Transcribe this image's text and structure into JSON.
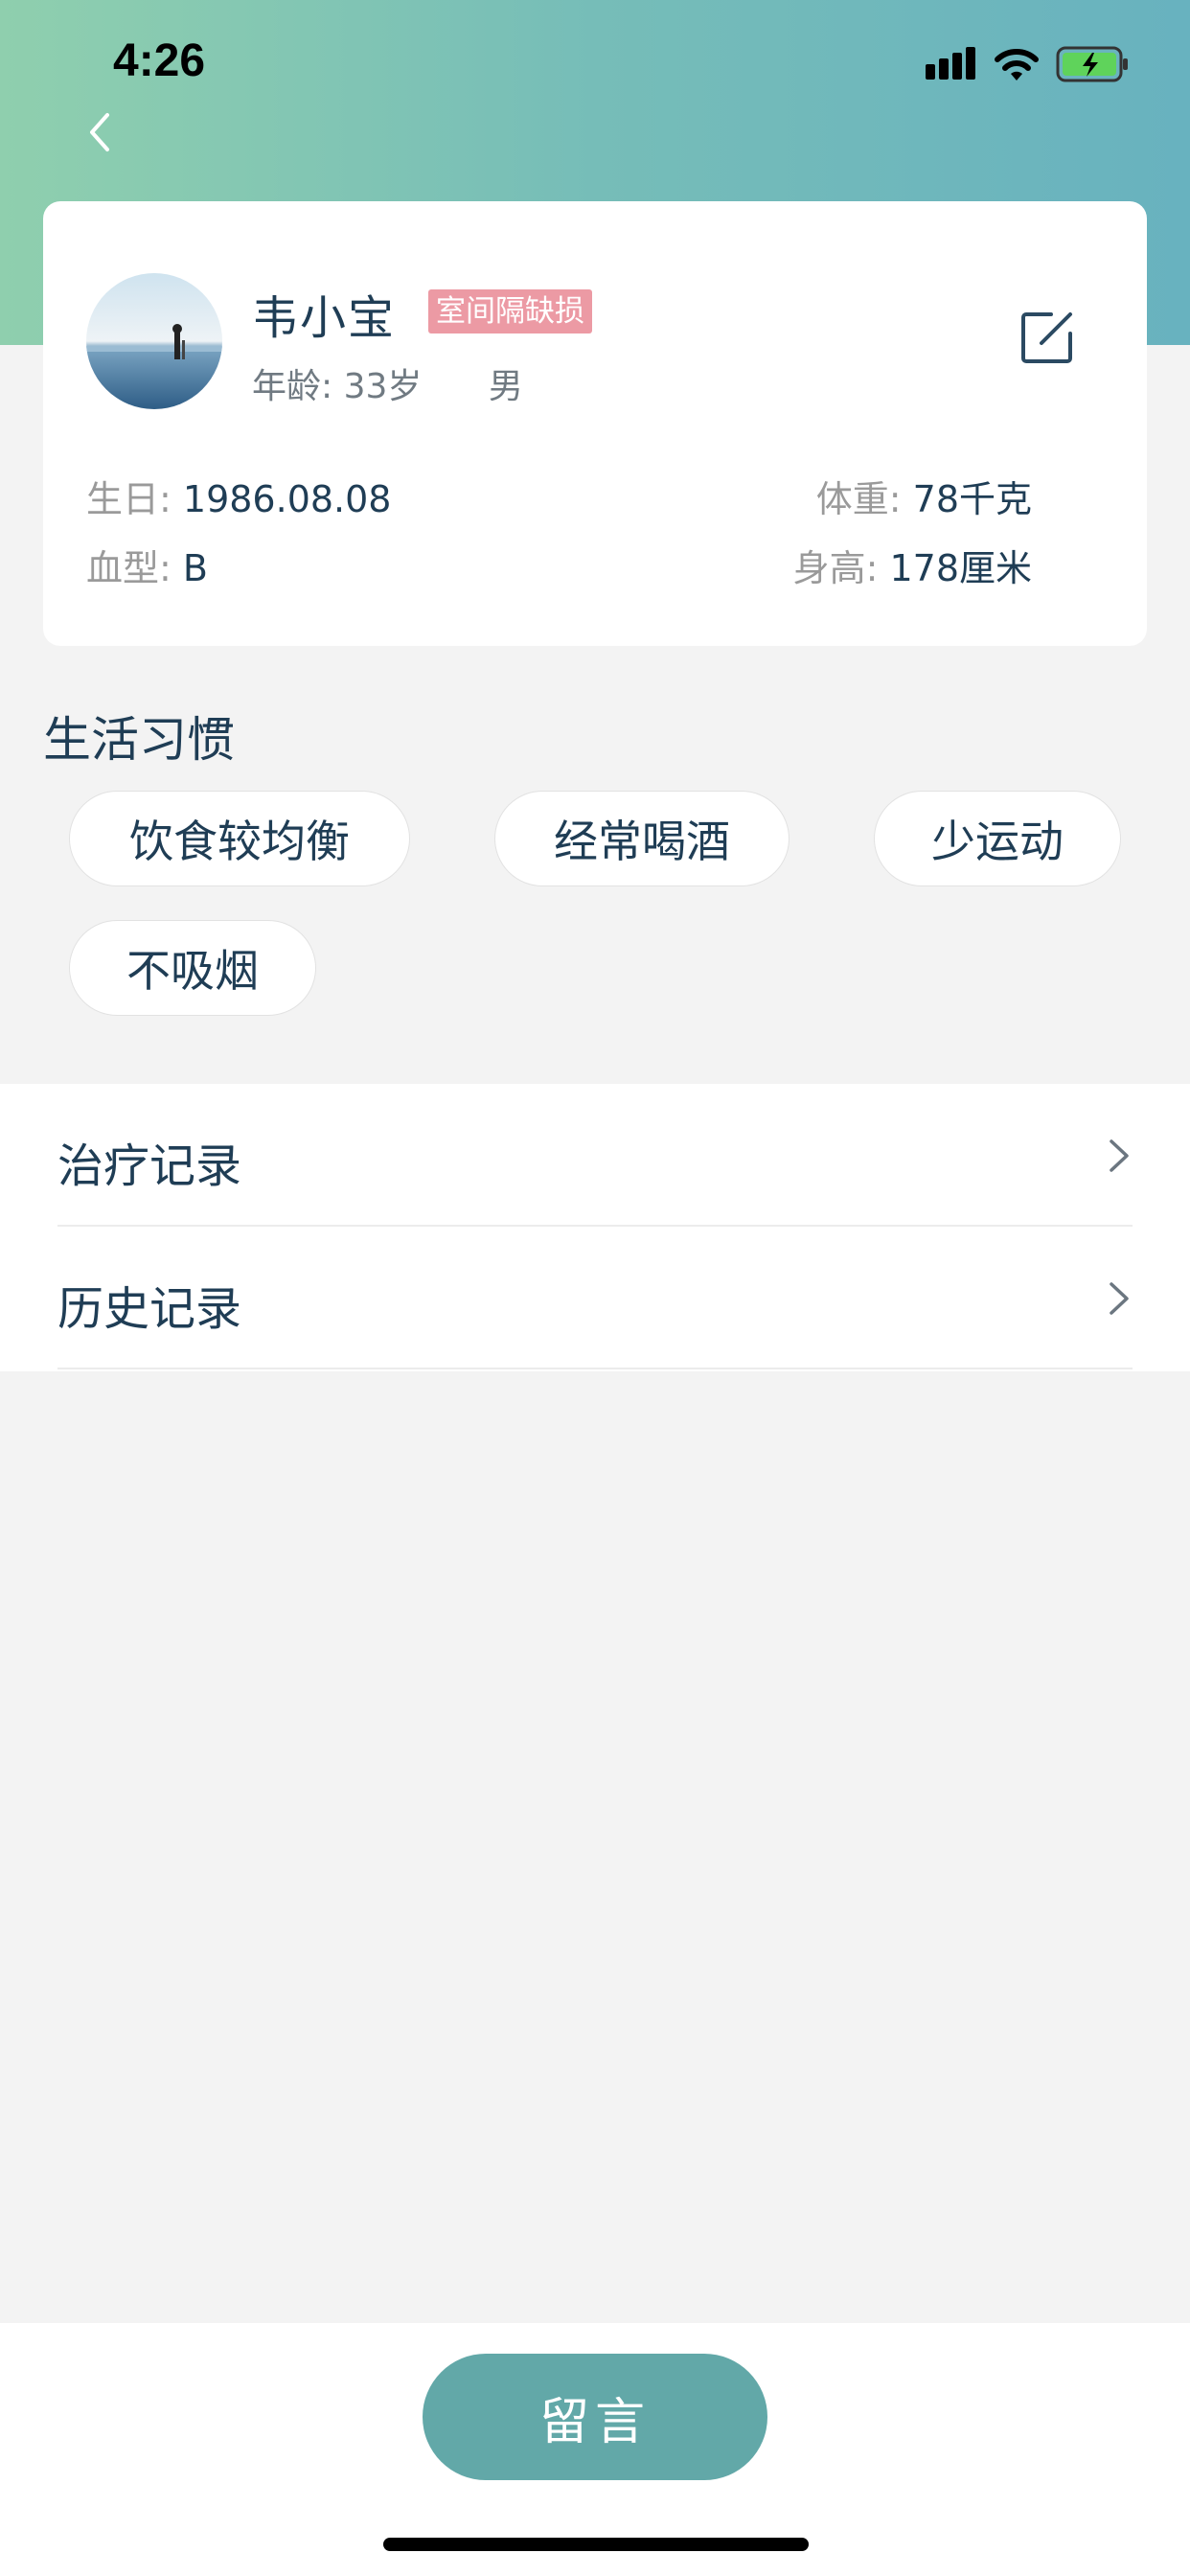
{
  "status_bar": {
    "time": "4:26"
  },
  "profile": {
    "name": "韦小宝",
    "tag": "室间隔缺损",
    "age_label": "年龄:",
    "age_value": "33岁",
    "gender": "男",
    "birthday_label": "生日:",
    "birthday_value": "1986.08.08",
    "blood_label": "血型:",
    "blood_value": "B",
    "weight_label": "体重:",
    "weight_value": "78千克",
    "height_label": "身高:",
    "height_value": "178厘米"
  },
  "habits": {
    "title": "生活习惯",
    "items": [
      "饮食较均衡",
      "经常喝酒",
      "少运动",
      "不吸烟"
    ]
  },
  "menu": {
    "items": [
      {
        "label": "治疗记录"
      },
      {
        "label": "历史记录"
      }
    ]
  },
  "bottom": {
    "message_label": "留言"
  },
  "colors": {
    "accent": "#62a8a8",
    "tag_bg": "#ec9aa4",
    "text_primary": "#1f3d55",
    "header_gradient_start": "#8fcfae",
    "header_gradient_end": "#68b2bf"
  }
}
